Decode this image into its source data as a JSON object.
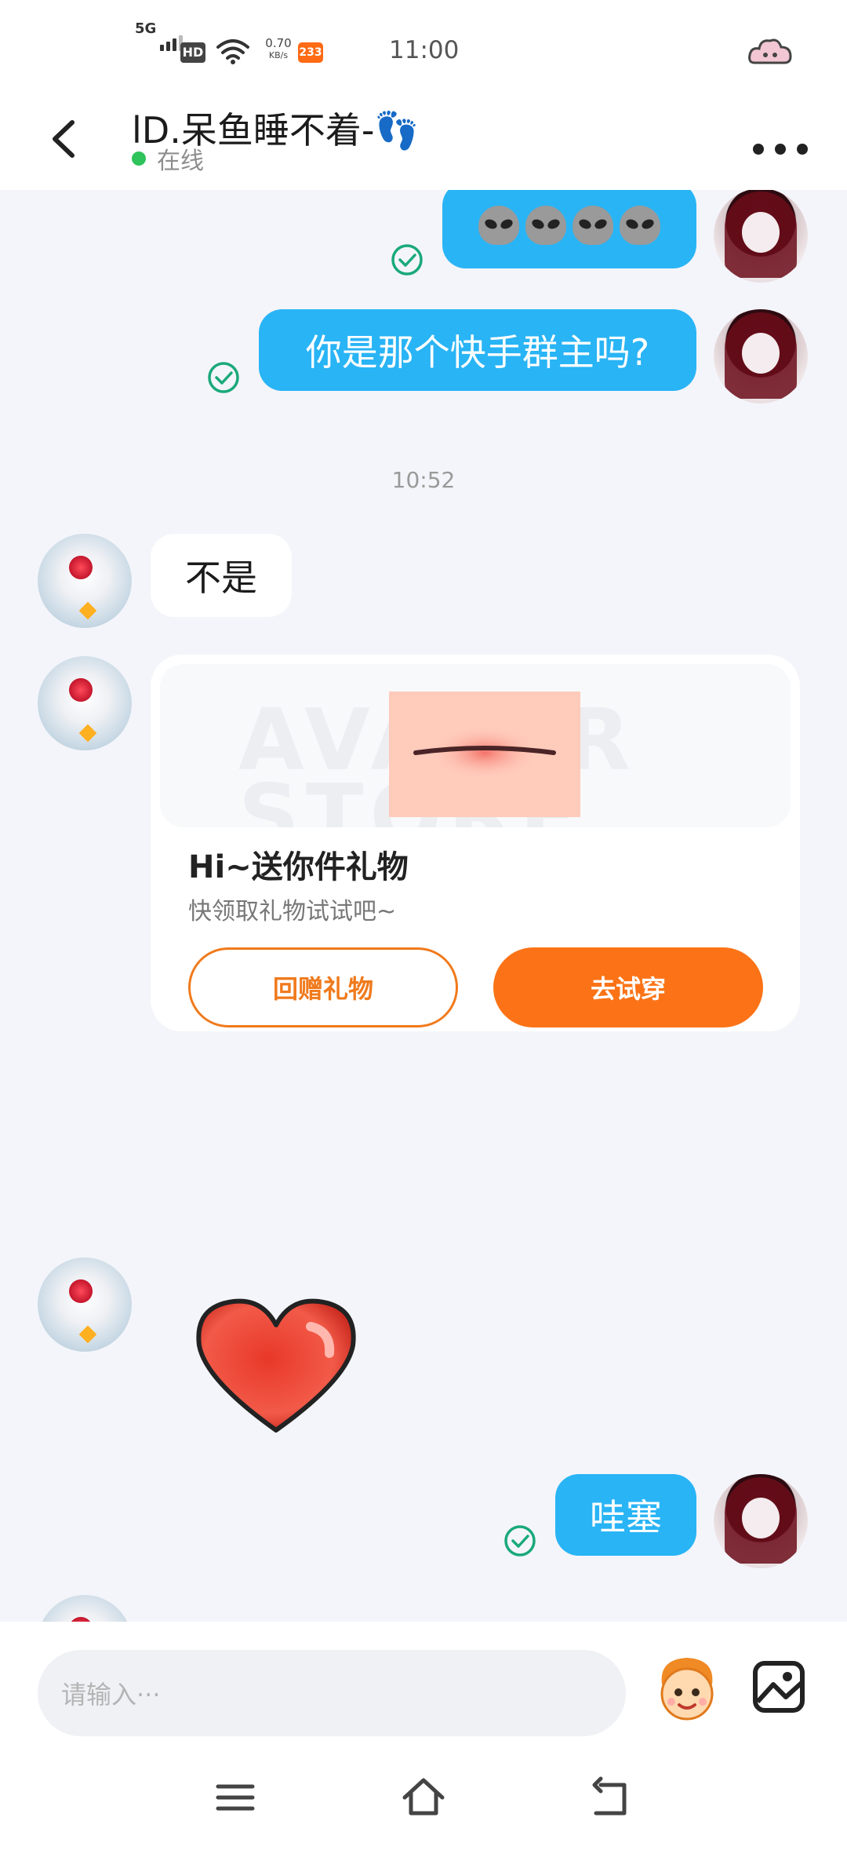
{
  "status_bar": {
    "network": "5G",
    "hd": "HD",
    "speed_value": "0.70",
    "speed_unit": "KB/s",
    "app_badge": "233",
    "time": "11:00"
  },
  "header": {
    "contact_name": "lD.呆鱼睡不着-👣",
    "status": "在线"
  },
  "messages": {
    "out_1_content": "alien-emoji x4",
    "out_2_text": "你是那个快手群主吗?",
    "timestamp": "10:52",
    "in_1_text": "不是",
    "out_3_text": "哇塞"
  },
  "gift_card": {
    "watermark": "AVATAR STORE",
    "title": "Hi~送你件礼物",
    "description": "快领取礼物试试吧~",
    "return_gift_label": "回赠礼物",
    "try_on_label": "去试穿"
  },
  "input": {
    "placeholder": "请输入···"
  },
  "icons": {
    "back": "back-arrow-icon",
    "more": "more-dots-icon",
    "read_check": "read-check-icon",
    "sticker": "sticker-icon",
    "image": "image-icon",
    "nav_menu": "menu-icon",
    "nav_home": "home-icon",
    "nav_back": "nav-back-icon"
  },
  "colors": {
    "outgoing_bubble": "#29b4f5",
    "accent_orange": "#fb7316",
    "online_green": "#2ec35b",
    "check_green": "#1aa97a"
  }
}
